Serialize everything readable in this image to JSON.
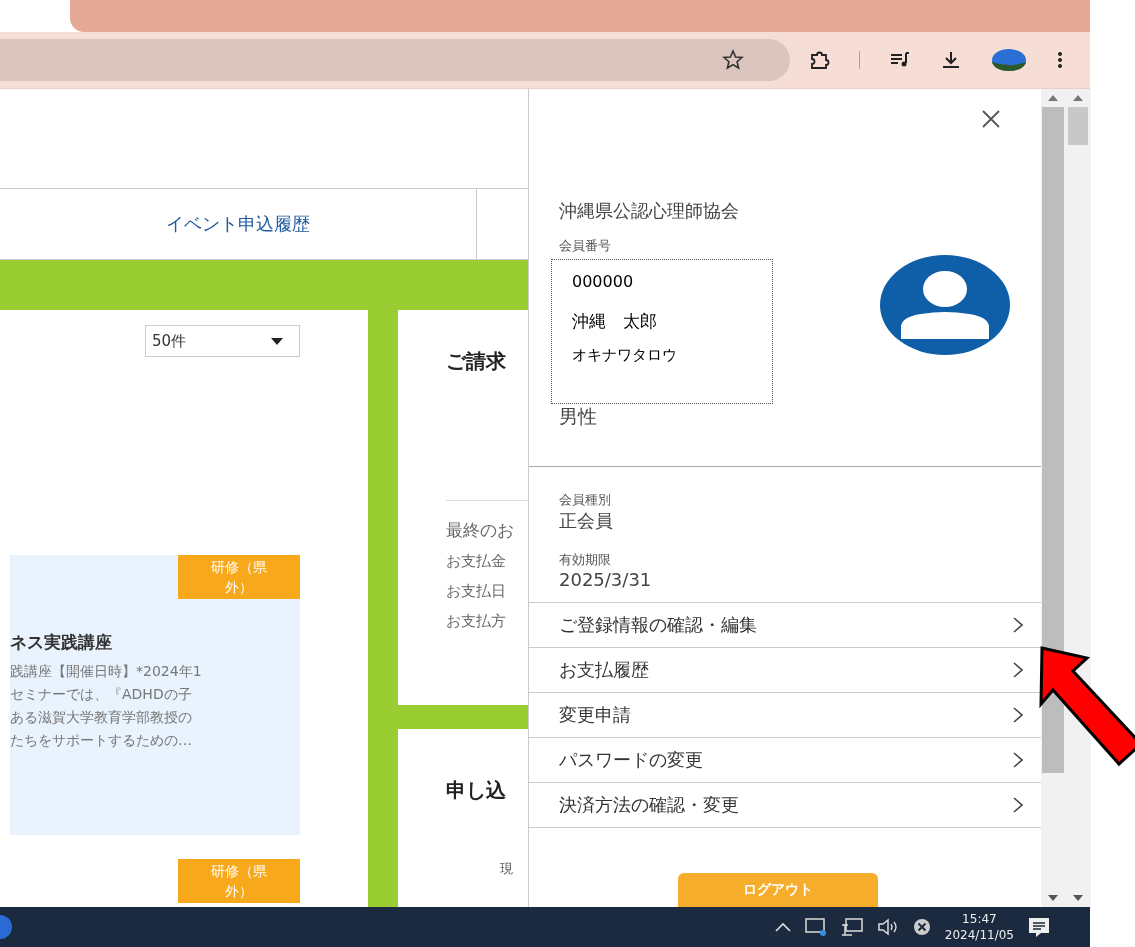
{
  "page": {
    "tab": "イベント申込履歴",
    "page_size": "50件",
    "cards": [
      {
        "badge": "研修（県外）",
        "title": "ネス実践講座",
        "description": [
          "践講座【開催日時】*2024年1",
          "セミナーでは、『ADHDの子",
          "ある滋賀大学教育学部教授の",
          "たちをサポートするための…"
        ]
      },
      {
        "badge": "研修（県外）"
      }
    ],
    "billing": {
      "heading": "ご請求",
      "last": "最終のお",
      "rows": [
        "お支払金",
        "お支払日",
        "お支払方"
      ]
    },
    "application": {
      "heading": "申し込",
      "current": "現"
    }
  },
  "panel": {
    "org": "沖縄県公認心理師協会",
    "member_no_label": "会員番号",
    "member_no": "000000",
    "name": "沖縄　太郎",
    "kana": "オキナワタロウ",
    "gender": "男性",
    "type_label": "会員種別",
    "type": "正会員",
    "expiry_label": "有効期限",
    "expiry": "2025/3/31",
    "menu": [
      "ご登録情報の確認・編集",
      "お支払履歴",
      "変更申請",
      "パスワードの変更",
      "決済方法の確認・変更"
    ],
    "logout": "ログアウト"
  },
  "taskbar": {
    "time": "15:47",
    "date": "2024/11/05"
  }
}
